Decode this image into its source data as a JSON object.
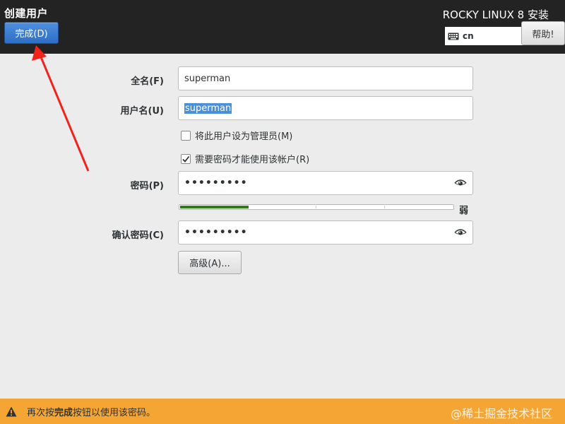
{
  "header": {
    "page_title": "创建用户",
    "done_button": "完成(D)",
    "installer_title": "ROCKY LINUX 8 安装",
    "keyboard_layout": "cn",
    "help_button": "帮助!"
  },
  "form": {
    "fullname_label": "全名(F)",
    "fullname_value": "superman",
    "username_label": "用户名(U)",
    "username_value": "superman",
    "admin_checkbox_label": "将此用户设为管理员(M)",
    "admin_checked": false,
    "require_password_label": "需要密码才能使用该帐户(R)",
    "require_password_checked": true,
    "password_label": "密码(P)",
    "password_value": "•••••••••",
    "strength_fraction": 0.25,
    "strength_text": "弱",
    "confirm_label": "确认密码(C)",
    "confirm_value": "•••••••••",
    "advanced_button": "高级(A)..."
  },
  "warning": {
    "prefix": "再次按",
    "bold": "完成",
    "suffix": "按钮以使用该密码。"
  },
  "watermark": "@稀土掘金技术社区",
  "colors": {
    "header_bg": "#232323",
    "accent_blue": "#3577cc",
    "warning_bg": "#f5a533",
    "strength_green": "#2e7d16",
    "annotation_arrow": "#f0241c"
  }
}
